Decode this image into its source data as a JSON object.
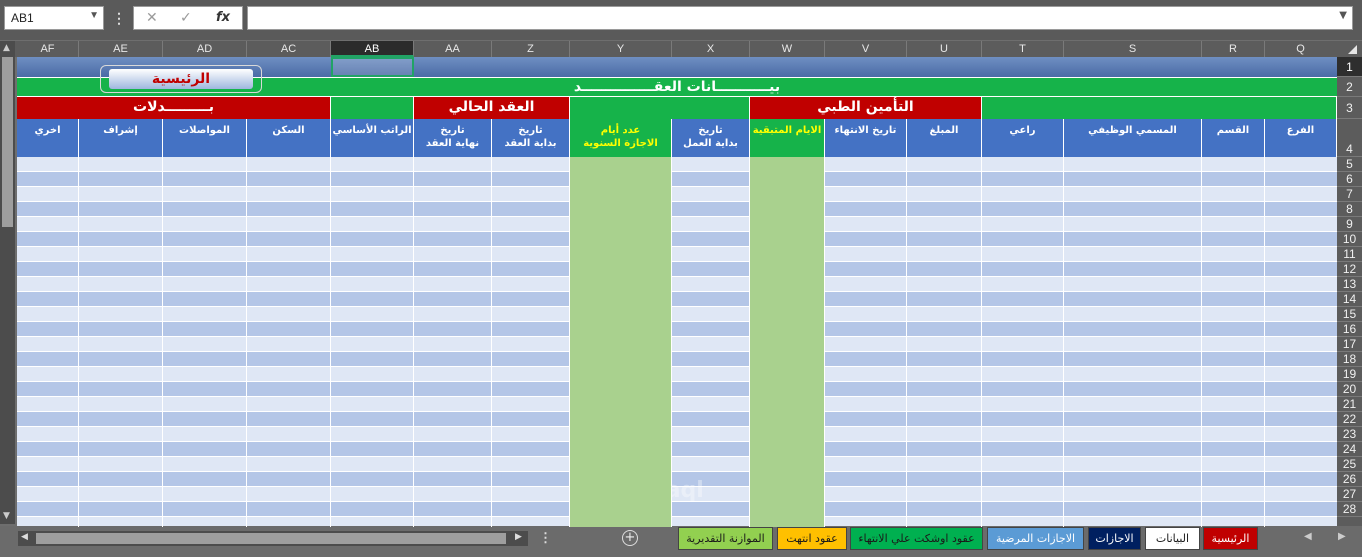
{
  "formula_bar": {
    "name_box": "AB1",
    "cancel_icon": "✕",
    "enter_icon": "✓",
    "fx_label": "fx",
    "formula": ""
  },
  "columns": [
    "AF",
    "AE",
    "AD",
    "AC",
    "AB",
    "AA",
    "Z",
    "Y",
    "X",
    "W",
    "V",
    "U",
    "T",
    "S",
    "R",
    "Q"
  ],
  "selected_column": "AB",
  "rows": [
    "1",
    "2",
    "3",
    "4",
    "5",
    "6",
    "7",
    "8",
    "9",
    "10",
    "11",
    "12",
    "13",
    "14",
    "15",
    "16",
    "17",
    "18",
    "19",
    "20",
    "21",
    "22",
    "23",
    "24",
    "25",
    "26",
    "27",
    "28"
  ],
  "sheet": {
    "home_button": "الرئيسية",
    "title": "بيـــــــــــانات العقـــــــــــــــد",
    "group_allowances": "بـــــــــدلات",
    "group_current_contract": "العقد الحالي",
    "group_medical_insurance": "التأمين الطبي",
    "headers": {
      "AF": "اخري",
      "AE": "إشراف",
      "AD": "المواصلات",
      "AC": "السكن",
      "AB": "الراتب الأساسي",
      "AA": "تاريخ\nنهاية العقد",
      "Z": "تاريخ\nبداية العقد",
      "Y": "عدد أيام\nالاجازة السنوية",
      "X": "تاريخ\nبداية العمل",
      "W": "الايام المتبقية",
      "V": "تاريخ الانتهاء",
      "U": "المبلغ",
      "T": "راعي",
      "S": "المسمي الوظيفي",
      "R": "القسم",
      "Q": "الفرع"
    }
  },
  "tabs": [
    {
      "label": "الموازنة التقديرية",
      "bg": "#92d050",
      "fg": "#1a1a1a"
    },
    {
      "label": "عقود انتهت",
      "bg": "#ffc000",
      "fg": "#1a1a1a"
    },
    {
      "label": "عقود اوشكت علي الانتهاء",
      "bg": "#00b050",
      "fg": "#1a1a1a"
    },
    {
      "label": "الاجازات المرضية",
      "bg": "#5b9bd5",
      "fg": "#ffffff"
    },
    {
      "label": "الاجازات",
      "bg": "#002060",
      "fg": "#ffffff"
    },
    {
      "label": "البيانات",
      "bg": "#ffffff",
      "fg": "#1a1a1a"
    },
    {
      "label": "الرئيسية",
      "bg": "#c00000",
      "fg": "#ffffff"
    }
  ],
  "watermark": "mostaql",
  "colors": {
    "blue_header": "#4472c4",
    "green_band": "#16b34a",
    "red_group": "#c00000",
    "green_column": "#a9d18e"
  }
}
